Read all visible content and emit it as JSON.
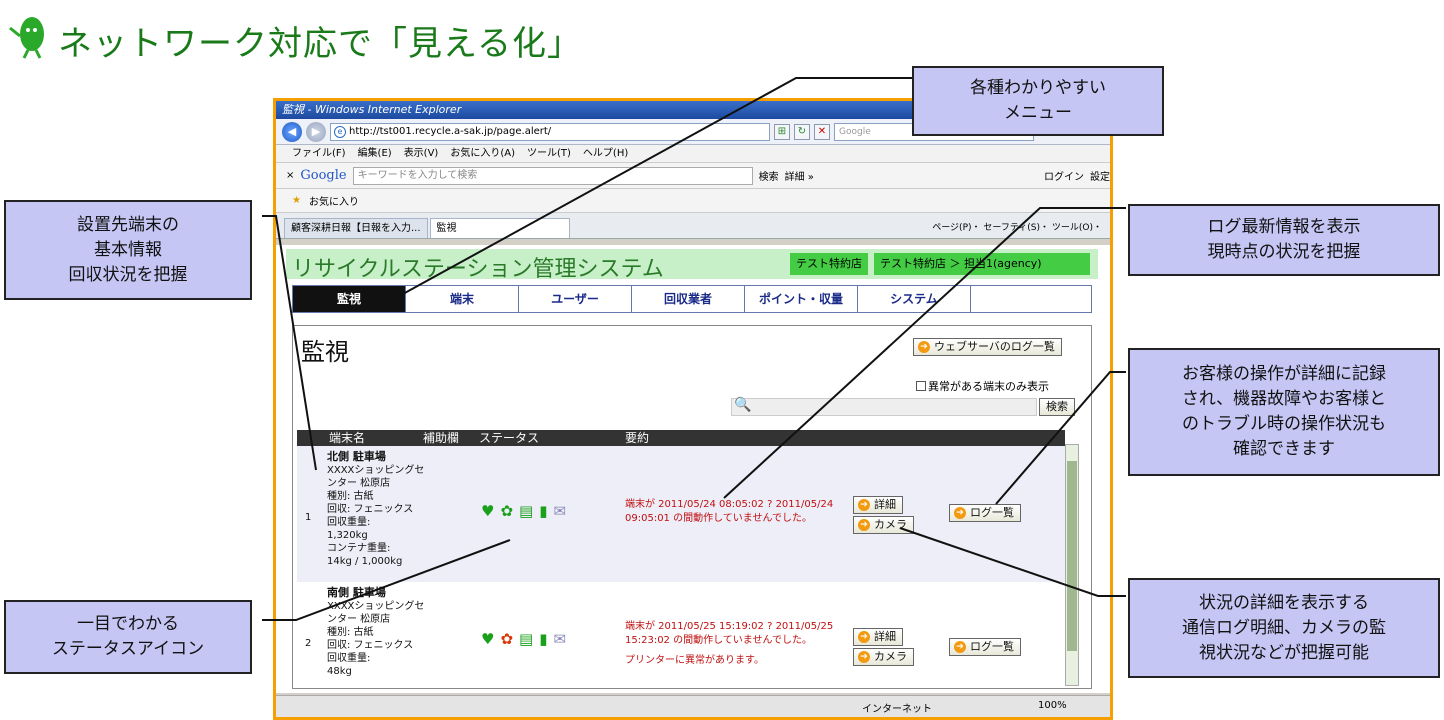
{
  "slide": {
    "title": "ネットワーク対応で「見える化」"
  },
  "browser": {
    "window_title": "監視 - Windows Internet Explorer",
    "url": "http://tst001.recycle.a-sak.jp/page.alert/",
    "search_placeholder": "Google",
    "menu": [
      "ファイル(F)",
      "編集(E)",
      "表示(V)",
      "お気に入り(A)",
      "ツール(T)",
      "ヘルプ(H)"
    ],
    "google_bar": {
      "logo": "Google",
      "placeholder": "キーワードを入力して検索",
      "search": "検索",
      "details": "詳細 »",
      "login": "ログイン",
      "settings": "設定"
    },
    "favorites": "お気に入り",
    "tabs": [
      "顧客深耕日報【日報を入力...",
      "監視"
    ],
    "tab_tools": "ページ(P)・ セーフティ(S)・ ツール(O)・",
    "status_zone": "インターネット",
    "zoom": "100%"
  },
  "app": {
    "title": "リサイクルステーション管理システム",
    "store": "テスト特約店",
    "agent": "テスト特約店 ＞ 担当1(agency)",
    "nav": [
      "監視",
      "端末",
      "ユーザー",
      "回収業者",
      "ポイント・収量",
      "システム"
    ],
    "page_title": "監視",
    "web_log_button": "ウェブサーバのログ一覧",
    "filter_label": "異常がある端末のみ表示",
    "search_button": "検索",
    "table_headers": [
      "端末名",
      "補助欄",
      "ステータス",
      "要約"
    ],
    "rows": [
      {
        "num": "1",
        "name": "北側 駐車場",
        "lines": [
          "XXXXショッピングセ",
          "ンター 松原店",
          "種別: 古紙",
          "回収: フェニックス",
          "回収重量:",
          "1,320kg",
          "コンテナ重量:",
          "14kg / 1,000kg"
        ],
        "summary": [
          "端末が 2011/05/24 08:05:02 ? 2011/05/24",
          "09:05:01 の間動作していませんでした。"
        ],
        "detail": "詳細",
        "camera": "カメラ",
        "log": "ログ一覧"
      },
      {
        "num": "2",
        "name": "南側 駐車場",
        "lines": [
          "XXXXショッピングセ",
          "ンター 松原店",
          "種別: 古紙",
          "回収: フェニックス",
          "回収重量:",
          "48kg"
        ],
        "summary": [
          "端末が 2011/05/25 15:19:02 ? 2011/05/25",
          "15:23:02 の間動作していませんでした。"
        ],
        "summary_extra": "プリンターに異常があります。",
        "detail": "詳細",
        "camera": "カメラ",
        "log": "ログ一覧"
      }
    ]
  },
  "callouts": {
    "menu": [
      "各種わかりやすい",
      "メニュー"
    ],
    "terminal": [
      "設置先端末の",
      "基本情報",
      "回収状況を把握"
    ],
    "log_latest": [
      "ログ最新情報を表示",
      "現時点の状況を把握"
    ],
    "operations": [
      "お客様の操作が詳細に記録",
      "され、機器故障やお客様と",
      "のトラブル時の操作状況も",
      "確認できます"
    ],
    "status_icons": [
      "一目でわかる",
      "ステータスアイコン"
    ],
    "details": [
      "状況の詳細を表示する",
      "通信ログ明細、カメラの監",
      "視状況などが把握可能"
    ]
  }
}
